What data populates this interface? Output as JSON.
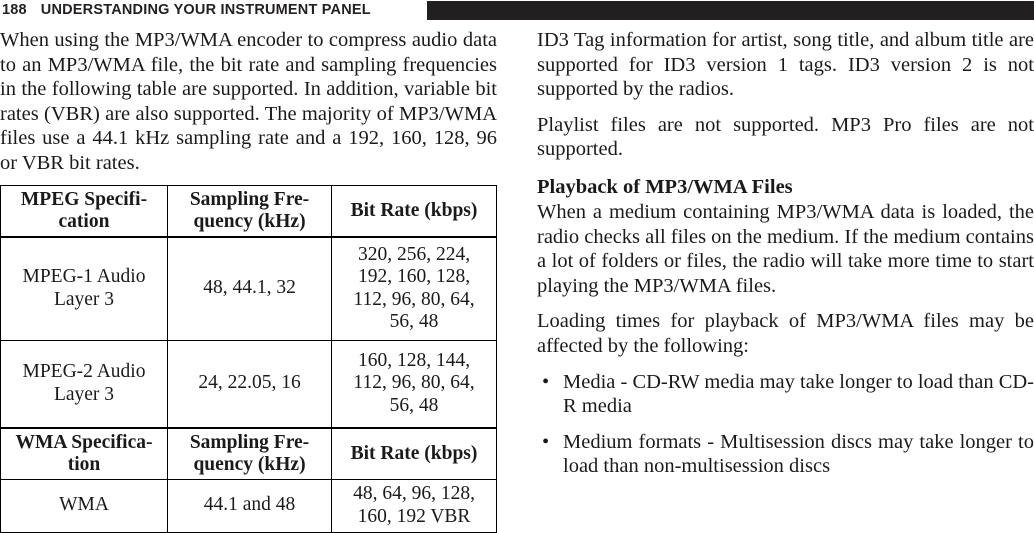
{
  "header": {
    "page_number": "188",
    "title": "UNDERSTANDING YOUR INSTRUMENT PANEL",
    "bar_color": "#231f20"
  },
  "left_column": {
    "intro_paragraph": "When using the MP3/WMA encoder to compress audio data to an MP3/WMA file, the bit rate and sampling frequencies in the following table are supported. In addition, variable bit rates (VBR) are also supported. The majority of MP3/WMA files use a 44.1 kHz sampling rate and a 192, 160, 128, 96 or VBR bit rates.",
    "table": {
      "mpeg_headers": {
        "spec": "MPEG Specifi-cation",
        "spec_line1": "MPEG Specifi-",
        "spec_line2": "cation",
        "frequency_line1": "Sampling Fre-",
        "frequency_line2": "quency (kHz)",
        "bit_rate": "Bit Rate (kbps)"
      },
      "mpeg_rows": [
        {
          "spec_line1": "MPEG-1 Audio",
          "spec_line2": "Layer 3",
          "frequency": "48, 44.1, 32",
          "bit_rate_lines": [
            "320, 256, 224,",
            "192, 160, 128,",
            "112, 96, 80, 64,",
            "56, 48"
          ]
        },
        {
          "spec_line1": "MPEG-2 Audio",
          "spec_line2": "Layer 3",
          "frequency": "24, 22.05, 16",
          "bit_rate_lines": [
            "160, 128, 144,",
            "112, 96, 80, 64,",
            "56, 48"
          ]
        }
      ],
      "wma_headers": {
        "spec_line1": "WMA Specifica-",
        "spec_line2": "tion",
        "frequency_line1": "Sampling Fre-",
        "frequency_line2": "quency (kHz)",
        "bit_rate": "Bit Rate (kbps)"
      },
      "wma_rows": [
        {
          "spec": "WMA",
          "frequency": "44.1 and 48",
          "bit_rate_lines": [
            "48, 64, 96, 128,",
            "160, 192 VBR"
          ]
        }
      ]
    }
  },
  "right_column": {
    "paragraph_id3": "ID3 Tag information for artist, song title, and album title are supported for ID3 version 1 tags. ID3 version 2 is not supported by the radios.",
    "paragraph_playlist": "Playlist files are not supported. MP3 Pro files are not supported.",
    "heading_playback": "Playback of MP3/WMA Files",
    "paragraph_playback": "When a medium containing MP3/WMA data is loaded, the radio checks all files on the medium. If the medium contains a lot of folders or files, the radio will take more time to start playing the MP3/WMA files.",
    "paragraph_loading": "Loading times for playback of MP3/WMA files may be affected by the following:",
    "bullets": [
      {
        "marker": "•",
        "text": "Media - CD-RW media may take longer to load than CD-R media"
      },
      {
        "marker": "•",
        "text": "Medium formats - Multisession discs may take longer to load than non-multisession discs"
      }
    ]
  }
}
